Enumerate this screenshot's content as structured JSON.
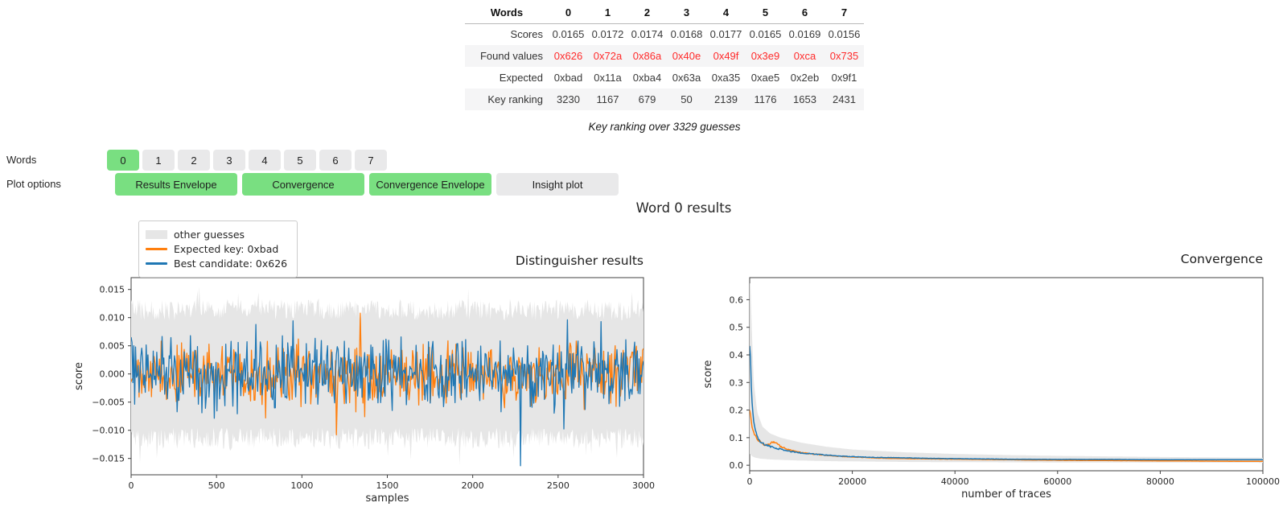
{
  "figure_title": "Word 0 results",
  "table": {
    "header": [
      "Words",
      "0",
      "1",
      "2",
      "3",
      "4",
      "5",
      "6",
      "7"
    ],
    "rows": [
      {
        "label": "Scores",
        "values": [
          "0.0165",
          "0.0172",
          "0.0174",
          "0.0168",
          "0.0177",
          "0.0165",
          "0.0169",
          "0.0156"
        ],
        "style": "normal",
        "striped": false
      },
      {
        "label": "Found values",
        "values": [
          "0x626",
          "0x72a",
          "0x86a",
          "0x40e",
          "0x49f",
          "0x3e9",
          "0xca",
          "0x735"
        ],
        "style": "red",
        "striped": true
      },
      {
        "label": "Expected",
        "values": [
          "0xbad",
          "0x11a",
          "0xba4",
          "0x63a",
          "0xa35",
          "0xae5",
          "0x2eb",
          "0x9f1"
        ],
        "style": "normal",
        "striped": false
      },
      {
        "label": "Key ranking",
        "values": [
          "3230",
          "1167",
          "679",
          "50",
          "2139",
          "1176",
          "1653",
          "2431"
        ],
        "style": "normal",
        "striped": true
      }
    ],
    "caption": "Key ranking over 3329 guesses"
  },
  "controls": {
    "words_label": "Words",
    "plot_options_label": "Plot options",
    "word_buttons": [
      {
        "label": "0",
        "selected": true
      },
      {
        "label": "1",
        "selected": false
      },
      {
        "label": "2",
        "selected": false
      },
      {
        "label": "3",
        "selected": false
      },
      {
        "label": "4",
        "selected": false
      },
      {
        "label": "5",
        "selected": false
      },
      {
        "label": "6",
        "selected": false
      },
      {
        "label": "7",
        "selected": false
      }
    ],
    "plot_buttons": [
      {
        "label": "Results Envelope",
        "selected": true
      },
      {
        "label": "Convergence",
        "selected": true
      },
      {
        "label": "Convergence Envelope",
        "selected": true
      },
      {
        "label": "Insight plot",
        "selected": false
      }
    ]
  },
  "legend": {
    "entries": [
      {
        "label": "other guesses",
        "type": "patch",
        "color_key": "envelope"
      },
      {
        "label": "Expected key: 0xbad",
        "type": "line",
        "color_key": "orange"
      },
      {
        "label": "Best candidate: 0x626",
        "type": "line",
        "color_key": "blue"
      }
    ]
  },
  "colors": {
    "accent_green": "#79df81",
    "button_gray": "#e9e9ea",
    "found_red": "#ff2b2b",
    "stripe": "#f5f5f6",
    "orange": "#ff7f0e",
    "blue": "#1f77b4",
    "envelope": "#e6e6e6",
    "axis": "#404040"
  },
  "chart_data": [
    {
      "id": "distinguisher",
      "type": "line",
      "title": "Distinguisher results",
      "xlabel": "samples",
      "ylabel": "score",
      "xlim": [
        0,
        3000
      ],
      "ylim": [
        -0.0179,
        0.0171
      ],
      "xticks": [
        0,
        500,
        1000,
        1500,
        2000,
        2500,
        3000
      ],
      "ytick_values": [
        0.015,
        0.01,
        0.005,
        0.0,
        -0.005,
        -0.01,
        -0.015
      ],
      "ytick_labels": [
        "0.015",
        "0.010",
        "0.005",
        "0.000",
        "−0.005",
        "−0.010",
        "−0.015"
      ],
      "grid": false,
      "n_points": 580,
      "envelope": {
        "label": "other guesses",
        "base": 0.0095,
        "jitter": 0.0038
      },
      "series": [
        {
          "label": "Expected key: 0xbad",
          "color_key": "orange",
          "amp": 0.0042,
          "notable_spikes": [
            {
              "x": 790,
              "y": -0.0078
            },
            {
              "x": 1370,
              "y": -0.0076
            },
            {
              "x": 980,
              "y": 0.0062
            }
          ]
        },
        {
          "label": "Best candidate: 0x626",
          "color_key": "blue",
          "amp": 0.0046,
          "notable_spikes": [
            {
              "x": 730,
              "y": 0.0088
            },
            {
              "x": 2280,
              "y": -0.0163
            },
            {
              "x": 2750,
              "y": 0.0093
            }
          ]
        }
      ]
    },
    {
      "id": "convergence",
      "type": "line",
      "title": "Convergence",
      "xlabel": "number of traces",
      "ylabel": "score",
      "xlim": [
        0,
        100000
      ],
      "ylim": [
        -0.02,
        0.68
      ],
      "xticks": [
        0,
        20000,
        40000,
        60000,
        80000,
        100000
      ],
      "ytick_values": [
        0.0,
        0.1,
        0.2,
        0.3,
        0.4,
        0.5,
        0.6
      ],
      "ytick_labels": [
        "0.0",
        "0.1",
        "0.2",
        "0.3",
        "0.4",
        "0.5",
        "0.6"
      ],
      "grid": false,
      "envelope_upper": [
        [
          150,
          0.66
        ],
        [
          400,
          0.5
        ],
        [
          800,
          0.3
        ],
        [
          1500,
          0.19
        ],
        [
          2500,
          0.14
        ],
        [
          4000,
          0.115
        ],
        [
          6000,
          0.1
        ],
        [
          8000,
          0.091
        ],
        [
          10000,
          0.082
        ],
        [
          15000,
          0.067
        ],
        [
          20000,
          0.057
        ],
        [
          30000,
          0.047
        ],
        [
          40000,
          0.041
        ],
        [
          50000,
          0.037
        ],
        [
          60000,
          0.034
        ],
        [
          80000,
          0.03
        ],
        [
          100000,
          0.027
        ]
      ],
      "envelope_lower": [
        [
          150,
          0.04
        ],
        [
          500,
          0.032
        ],
        [
          1000,
          0.028
        ],
        [
          2000,
          0.024
        ],
        [
          4000,
          0.021
        ],
        [
          8000,
          0.018
        ],
        [
          15000,
          0.015
        ],
        [
          30000,
          0.012
        ],
        [
          60000,
          0.01
        ],
        [
          100000,
          0.009
        ]
      ],
      "series": [
        {
          "label": "Expected key: 0xbad",
          "color_key": "orange",
          "points": [
            [
              100,
              0.2
            ],
            [
              300,
              0.16
            ],
            [
              600,
              0.13
            ],
            [
              1000,
              0.11
            ],
            [
              1500,
              0.095
            ],
            [
              2000,
              0.085
            ],
            [
              2600,
              0.077
            ],
            [
              3200,
              0.072
            ],
            [
              3800,
              0.075
            ],
            [
              4300,
              0.083
            ],
            [
              4800,
              0.085
            ],
            [
              5300,
              0.078
            ],
            [
              6000,
              0.068
            ],
            [
              7000,
              0.06
            ],
            [
              8500,
              0.052
            ],
            [
              10000,
              0.046
            ],
            [
              12000,
              0.041
            ],
            [
              15000,
              0.036
            ],
            [
              18000,
              0.032
            ],
            [
              20000,
              0.03
            ],
            [
              25000,
              0.026
            ],
            [
              30000,
              0.024
            ],
            [
              35000,
              0.023
            ],
            [
              40000,
              0.022
            ],
            [
              50000,
              0.02
            ],
            [
              60000,
              0.018
            ],
            [
              70000,
              0.017
            ],
            [
              80000,
              0.016
            ],
            [
              90000,
              0.015
            ],
            [
              100000,
              0.014
            ]
          ]
        },
        {
          "label": "Best candidate: 0x626",
          "color_key": "blue",
          "points": [
            [
              100,
              0.435
            ],
            [
              250,
              0.32
            ],
            [
              400,
              0.25
            ],
            [
              600,
              0.19
            ],
            [
              900,
              0.145
            ],
            [
              1200,
              0.12
            ],
            [
              1600,
              0.1
            ],
            [
              2000,
              0.088
            ],
            [
              2600,
              0.078
            ],
            [
              3200,
              0.072
            ],
            [
              4000,
              0.068
            ],
            [
              5000,
              0.062
            ],
            [
              6000,
              0.058
            ],
            [
              7500,
              0.052
            ],
            [
              9000,
              0.047
            ],
            [
              11000,
              0.043
            ],
            [
              13000,
              0.04
            ],
            [
              15000,
              0.037
            ],
            [
              18000,
              0.033
            ],
            [
              20000,
              0.031
            ],
            [
              25000,
              0.028
            ],
            [
              30000,
              0.027
            ],
            [
              35000,
              0.025
            ],
            [
              40000,
              0.024
            ],
            [
              50000,
              0.022
            ],
            [
              60000,
              0.021
            ],
            [
              70000,
              0.021
            ],
            [
              80000,
              0.02
            ],
            [
              90000,
              0.02
            ],
            [
              100000,
              0.02
            ]
          ]
        }
      ]
    }
  ]
}
